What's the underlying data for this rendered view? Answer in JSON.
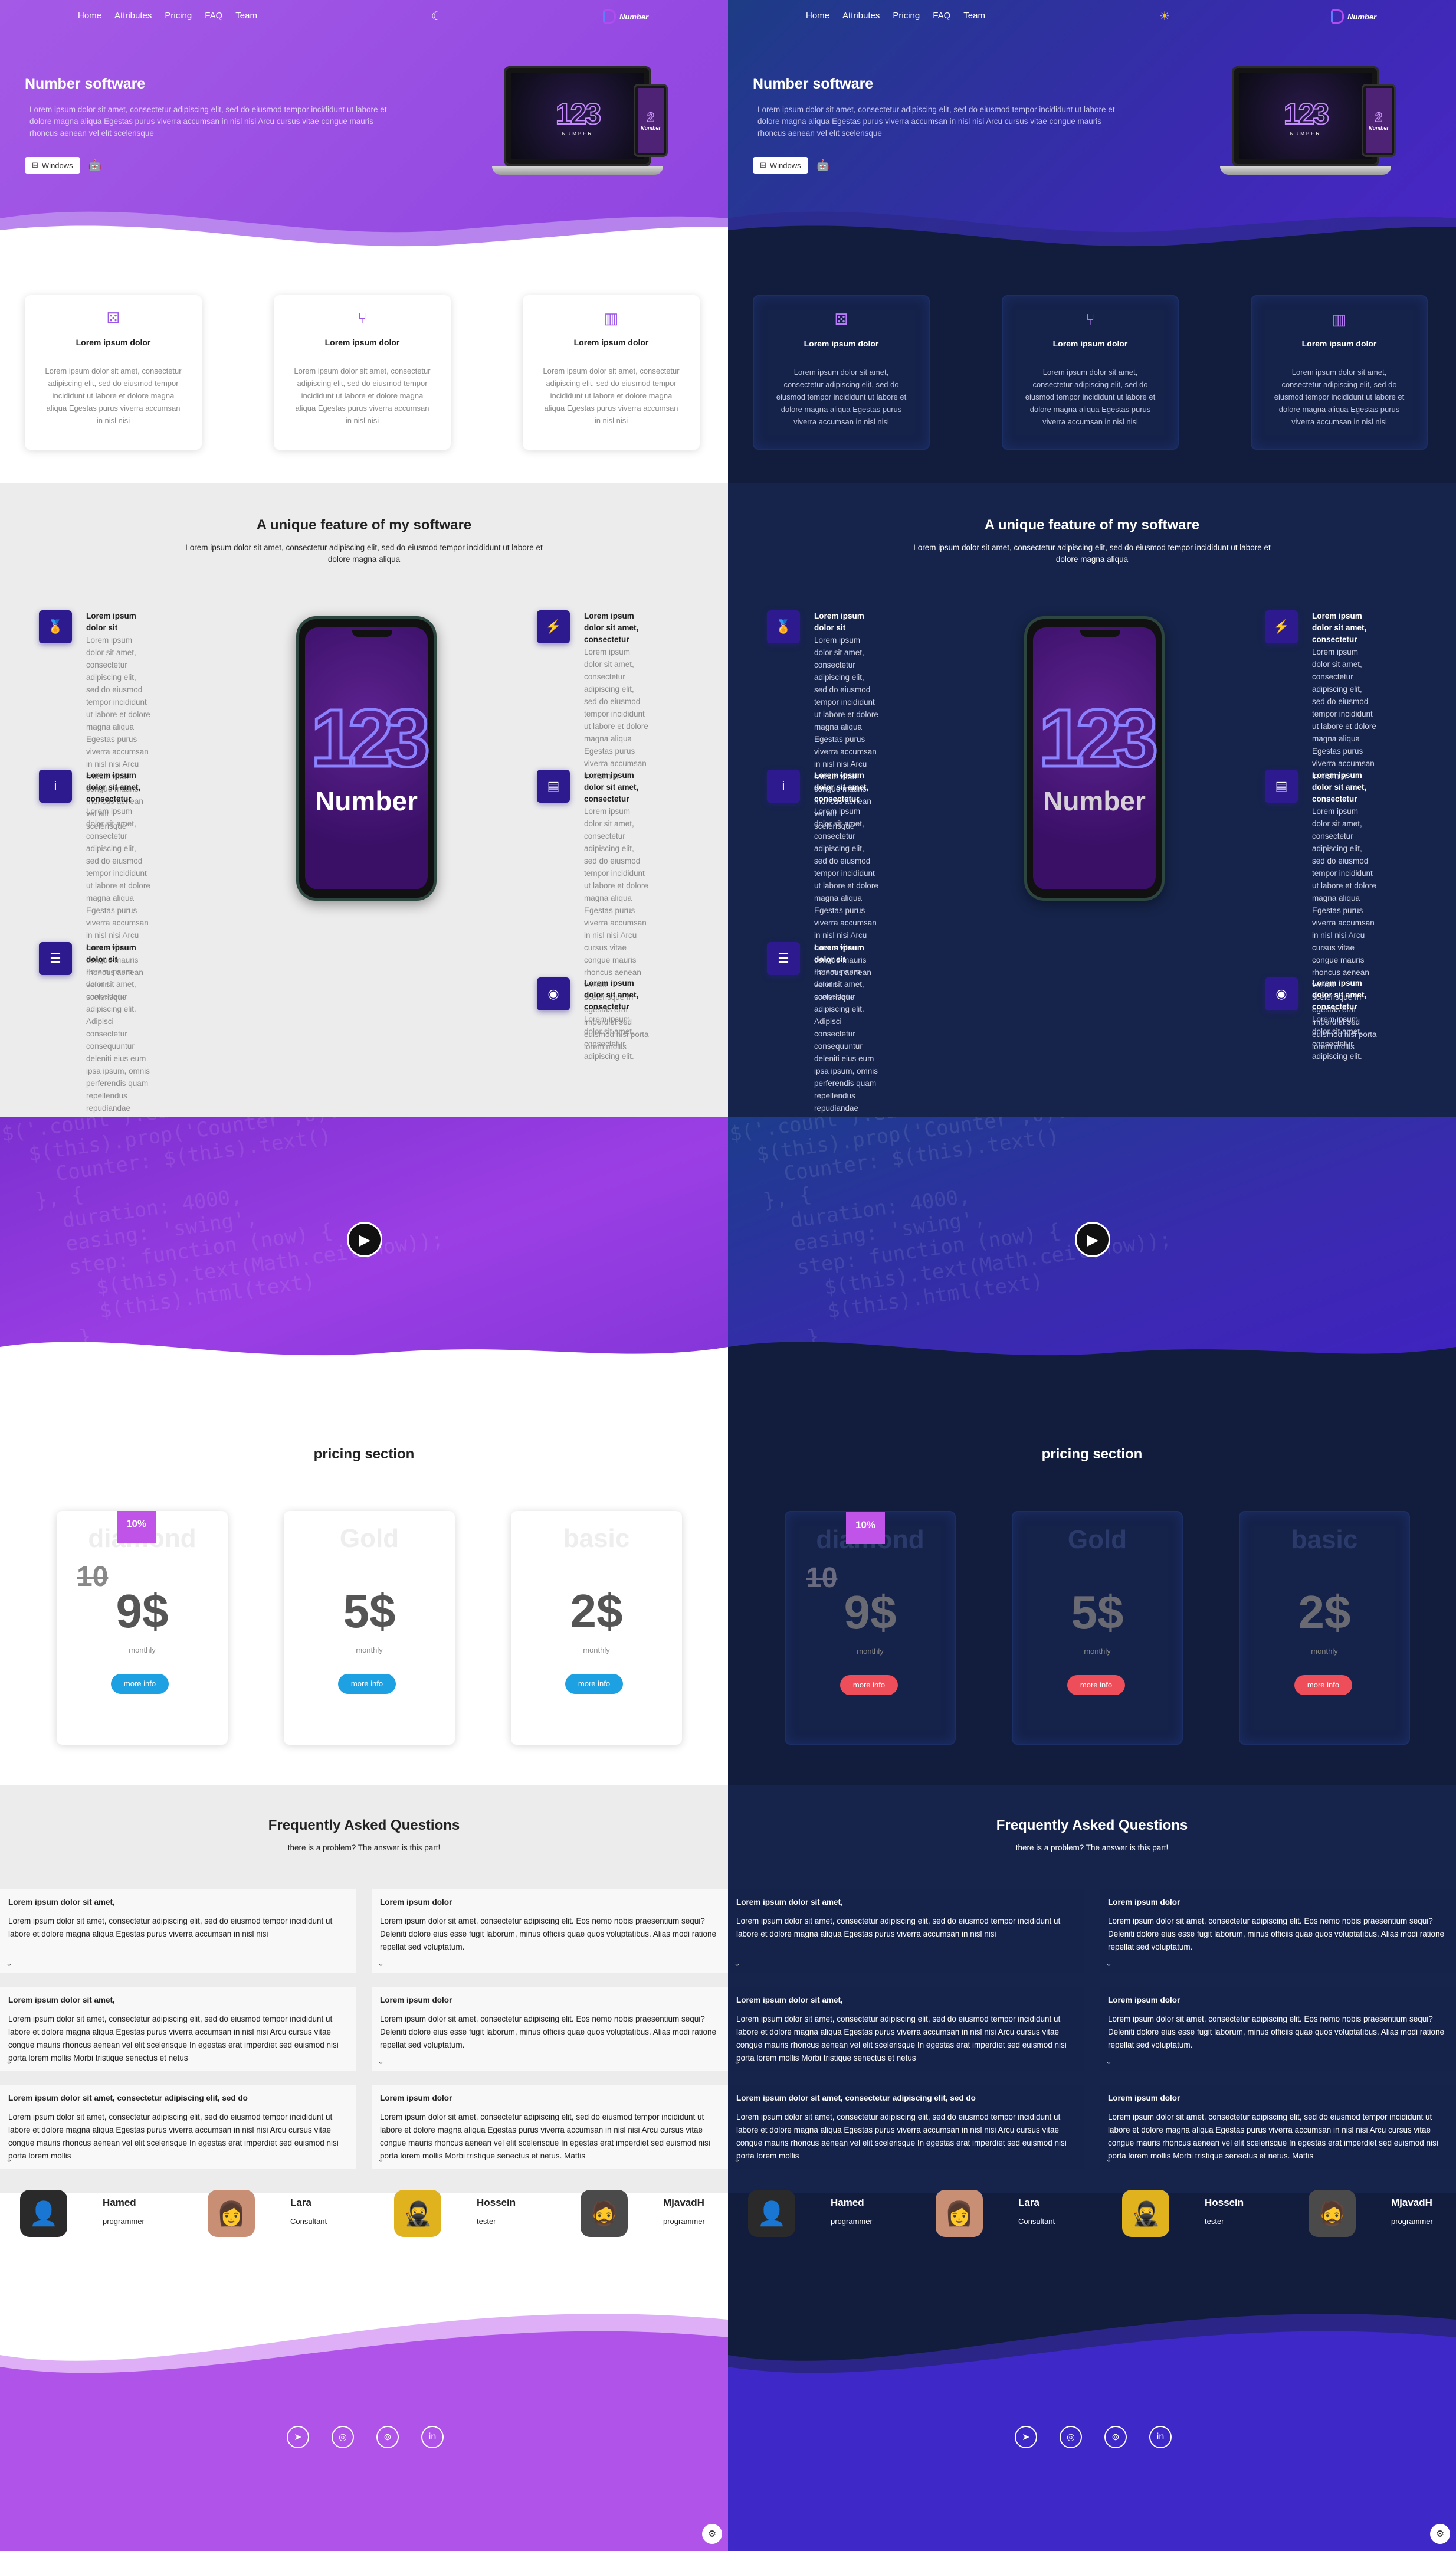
{
  "nav": [
    "Home",
    "Attributes",
    "Pricing",
    "FAQ",
    "Team"
  ],
  "brand": "Number",
  "hero": {
    "title": "Number software",
    "text": "Lorem ipsum dolor sit amet, consectetur adipiscing elit, sed do eiusmod tempor incididunt ut labore et dolore magna aliqua Egestas purus viverra accumsan in nisl nisi Arcu cursus vitae congue mauris rhoncus aenean vel elit scelerisque",
    "windows_label": "Windows",
    "laptop_brand": "NUMBER",
    "device_digits": "123"
  },
  "cards": [
    {
      "title": "Lorem ipsum dolor",
      "icon": "dice-icon",
      "text": "Lorem ipsum dolor sit amet, consectetur adipiscing elit, sed do eiusmod tempor incididunt ut labore et dolore magna aliqua Egestas purus viverra accumsan in nisl nisi"
    },
    {
      "title": "Lorem ipsum dolor",
      "icon": "git-branch-icon",
      "text": "Lorem ipsum dolor sit amet, consectetur adipiscing elit, sed do eiusmod tempor incididunt ut labore et dolore magna aliqua Egestas purus viverra accumsan in nisl nisi"
    },
    {
      "title": "Lorem ipsum dolor",
      "icon": "chart-icon",
      "text": "Lorem ipsum dolor sit amet, consectetur adipiscing elit, sed do eiusmod tempor incididunt ut labore et dolore magna aliqua Egestas purus viverra accumsan in nisl nisi"
    }
  ],
  "unique": {
    "title": "A unique feature of my software",
    "subtitle": "Lorem ipsum dolor sit amet, consectetur adipiscing elit, sed do eiusmod tempor incididunt ut labore et dolore magna aliqua",
    "phone_word": "Number",
    "left": [
      {
        "icon": "medal-icon",
        "title": "Lorem ipsum dolor sit",
        "text": "Lorem ipsum dolor sit amet, consectetur adipiscing elit, sed do eiusmod tempor incididunt ut labore et dolore magna aliqua Egestas purus viverra accumsan in nisl nisi Arcu cursus vitae congue mauris rhoncus aenean vel elit scelerisque"
      },
      {
        "icon": "info-icon",
        "title": "Lorem ipsum dolor sit amet, consectetur",
        "text": "Lorem ipsum dolor sit amet, consectetur adipiscing elit, sed do eiusmod tempor incididunt ut labore et dolore magna aliqua Egestas purus viverra accumsan in nisl nisi Arcu cursus vitae congue mauris rhoncus aenean vel elit scelerisque"
      },
      {
        "icon": "sliders-icon",
        "title": "Lorem ipsum dolor sit",
        "text": "Lorem ipsum dolor sit amet, consectetur adipiscing elit. Adipisci consectetur consequuntur deleniti eius eum ipsa ipsum, omnis perferendis quam repellendus repudiandae sapiente ullam velit veritatis voluptates! Eos impedit nihil soluta."
      }
    ],
    "right": [
      {
        "icon": "lightning-icon",
        "title": "Lorem ipsum dolor sit amet, consectetur",
        "text": "Lorem ipsum dolor sit amet, consectetur adipiscing elit, sed do eiusmod tempor incididunt ut labore et dolore magna aliqua Egestas purus viverra accumsan in nisl nisi"
      },
      {
        "icon": "document-icon",
        "title": "Lorem ipsum dolor sit amet, consectetur",
        "text": "Lorem ipsum dolor sit amet, consectetur adipiscing elit, sed do eiusmod tempor incididunt ut labore et dolore magna aliqua Egestas purus viverra accumsan in nisl nisi Arcu cursus vitae congue mauris rhoncus aenean vel elit scelerisque In egestas erat imperdiet sed euismod nisi porta lorem mollis"
      },
      {
        "icon": "camera-icon",
        "title": "Lorem ipsum dolor sit amet, consectetur",
        "text": "Lorem ipsum dolor sit amet, consectetur adipiscing elit."
      }
    ]
  },
  "video": {
    "code": "$('.count').each(function () {\n  $(this).prop('Counter',0).animate({\n    Counter: $(this).text()\n  }, {\n    duration: 4000,\n    easing: 'swing',\n    step: function (now) {\n      $(this).text(Math.ceil(now));\n      $(this).html(text)\n    }\n  });\n});\n   function(){\n   document.getElementById('objects')"
  },
  "pricing": {
    "title": "pricing section",
    "plans": [
      {
        "name": "diamond",
        "old": "10",
        "price": "9$",
        "period": "monthly",
        "button": "more info",
        "ribbon": "10%"
      },
      {
        "name": "Gold",
        "price": "5$",
        "period": "monthly",
        "button": "more info"
      },
      {
        "name": "basic",
        "price": "2$",
        "period": "monthly",
        "button": "more info"
      }
    ]
  },
  "faq": {
    "title": "Frequently Asked Questions",
    "subtitle": "there is a problem? The answer is this part!",
    "items": [
      {
        "q": "Lorem ipsum dolor sit amet,",
        "a": "Lorem ipsum dolor sit amet, consectetur adipiscing elit, sed do eiusmod tempor incididunt ut labore et dolore magna aliqua Egestas purus viverra accumsan in nisl nisi"
      },
      {
        "q": "Lorem ipsum dolor",
        "a": "Lorem ipsum dolor sit amet, consectetur adipiscing elit. Eos nemo nobis praesentium sequi? Deleniti dolore eius esse fugit laborum, minus officiis quae quos voluptatibus. Alias modi ratione repellat sed voluptatum."
      },
      {
        "q": "Lorem ipsum dolor sit amet,",
        "a": "Lorem ipsum dolor sit amet, consectetur adipiscing elit, sed do eiusmod tempor incididunt ut labore et dolore magna aliqua Egestas purus viverra accumsan in nisl nisi Arcu cursus vitae congue mauris rhoncus aenean vel elit scelerisque In egestas erat imperdiet sed euismod nisi porta lorem mollis Morbi tristique senectus et netus"
      },
      {
        "q": "Lorem ipsum dolor",
        "a": "Lorem ipsum dolor sit amet, consectetur adipiscing elit. Eos nemo nobis praesentium sequi? Deleniti dolore eius esse fugit laborum, minus officiis quae quos voluptatibus. Alias modi ratione repellat sed voluptatum."
      },
      {
        "q": "Lorem ipsum dolor sit amet, consectetur adipiscing elit, sed do",
        "a": "Lorem ipsum dolor sit amet, consectetur adipiscing elit, sed do eiusmod tempor incididunt ut labore et dolore magna aliqua Egestas purus viverra accumsan in nisl nisi Arcu cursus vitae congue mauris rhoncus aenean vel elit scelerisque In egestas erat imperdiet sed euismod nisi porta lorem mollis"
      },
      {
        "q": "Lorem ipsum dolor",
        "a": "Lorem ipsum dolor sit amet, consectetur adipiscing elit, sed do eiusmod tempor incididunt ut labore et dolore magna aliqua Egestas purus viverra accumsan in nisl nisi Arcu cursus vitae congue mauris rhoncus aenean vel elit scelerisque In egestas erat imperdiet sed euismod nisi porta lorem mollis Morbi tristique senectus et netus. Mattis"
      }
    ]
  },
  "team": [
    {
      "name": "Hamed",
      "role": "programmer"
    },
    {
      "name": "Lara",
      "role": "Consultant"
    },
    {
      "name": "Hossein",
      "role": "tester"
    },
    {
      "name": "MjavadH",
      "role": "programmer"
    }
  ],
  "colors": {
    "light_accent": "#a55ae6",
    "dark_bg": "#121c3d",
    "dark_accent": "#3a2ab0",
    "button_blue": "#1da1e2",
    "button_red": "#ee4e59",
    "ribbon": "#c053e8"
  }
}
